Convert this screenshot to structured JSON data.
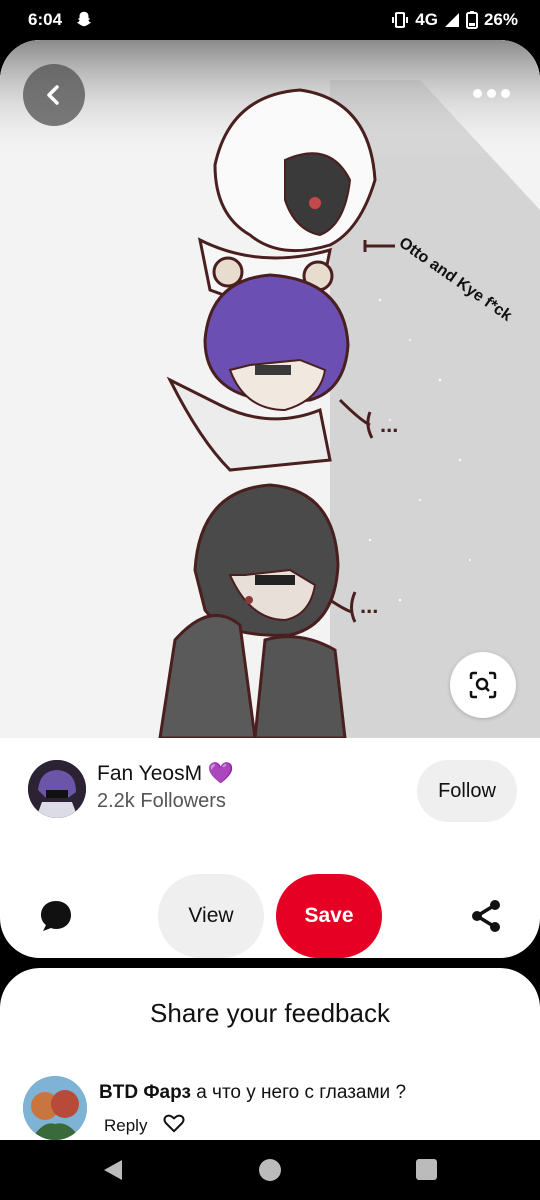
{
  "status_bar": {
    "time": "6:04",
    "network": "4G",
    "battery": "26%"
  },
  "pin": {
    "image_text": "Otto and Kye f*ck",
    "ellipsis_1": "...",
    "ellipsis_2": "..."
  },
  "creator": {
    "name": "Fan YeosM 💜",
    "followers": "2.2k Followers",
    "follow_label": "Follow"
  },
  "actions": {
    "view_label": "View",
    "save_label": "Save",
    "save_color": "#e60023"
  },
  "feedback": {
    "title": "Share your feedback",
    "comments": [
      {
        "user": "BTD Фарз",
        "text": "а что у него с глазами ?",
        "reply_label": "Reply"
      }
    ]
  },
  "icons": {
    "back": "chevron-left-icon",
    "more": "more-horizontal-icon",
    "lens": "visual-search-icon",
    "comment": "comment-icon",
    "share": "share-icon",
    "like": "heart-icon"
  }
}
